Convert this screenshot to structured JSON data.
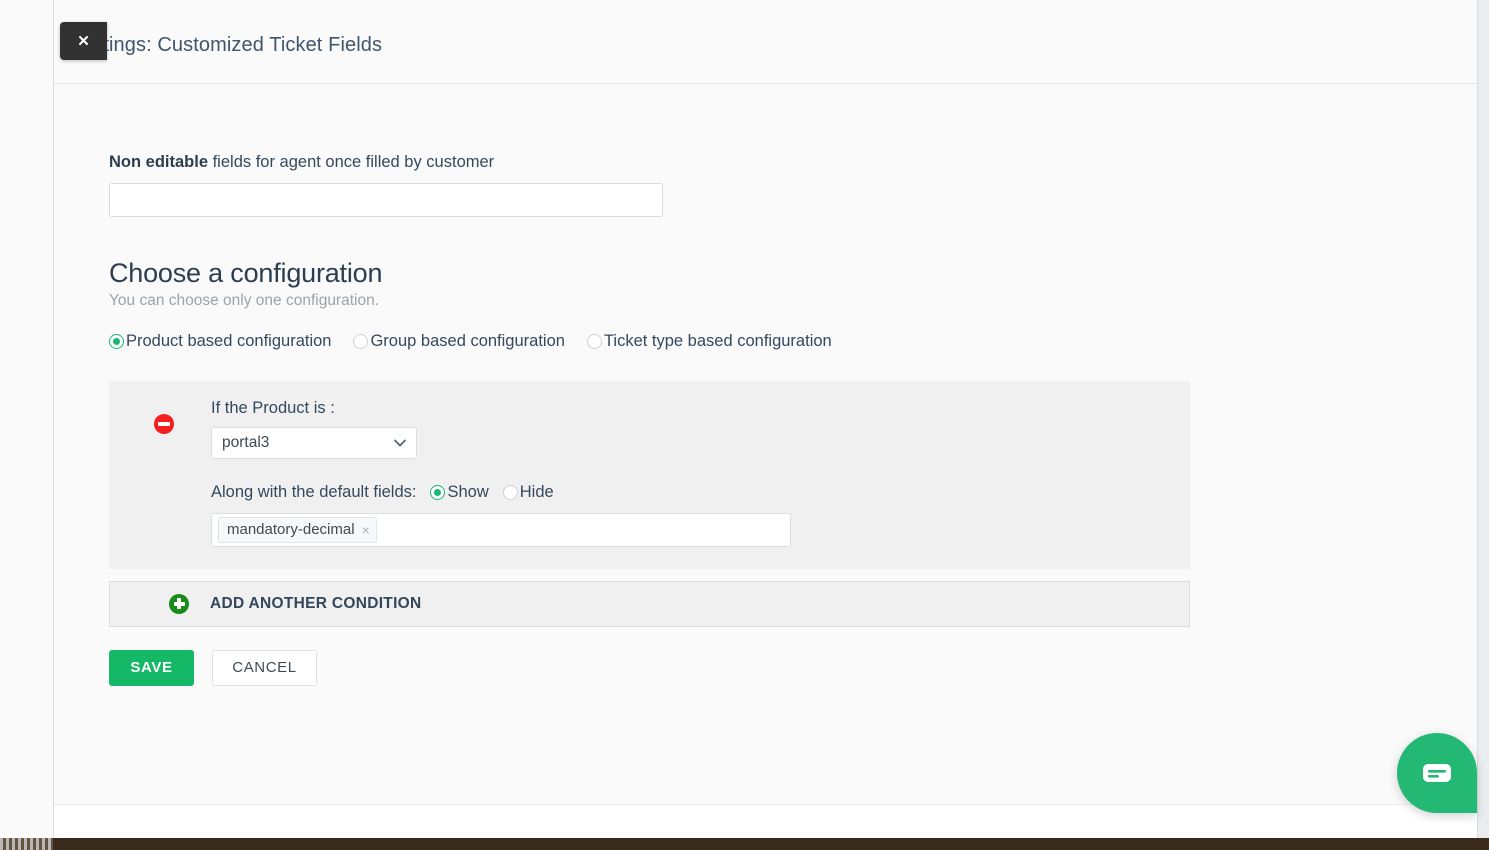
{
  "window": {
    "close_label": "✕",
    "title": "Settings: Customized Ticket Fields"
  },
  "noneditable": {
    "label_bold": "Non editable",
    "label_rest": " fields for agent once filled by customer",
    "value": "",
    "placeholder": ""
  },
  "configuration": {
    "heading": "Choose a configuration",
    "subtitle": "You can choose only one configuration.",
    "options": [
      {
        "label": "Product based configuration",
        "selected": true
      },
      {
        "label": "Group based configuration",
        "selected": false
      },
      {
        "label": "Ticket type based configuration",
        "selected": false
      }
    ]
  },
  "condition": {
    "remove_icon": "remove-circle-icon",
    "if_label": "If the Product is :",
    "product_value": "portal3",
    "default_fields_label": "Along with the default fields:",
    "visibility_options": [
      {
        "label": "Show",
        "selected": true
      },
      {
        "label": "Hide",
        "selected": false
      }
    ],
    "tags": [
      {
        "label": "mandatory-decimal",
        "remove": "×"
      }
    ]
  },
  "add_condition": {
    "icon": "plus-circle-icon",
    "label": "ADD ANOTHER CONDITION"
  },
  "actions": {
    "save_label": "SAVE",
    "cancel_label": "CANCEL"
  },
  "chat_widget": {
    "icon": "chat-bubble-icon"
  },
  "colors": {
    "accent_green": "#14b866",
    "radio_green": "#19b872",
    "remove_red": "#f41f1f",
    "add_green": "#1a8a1a",
    "title_text": "#41566c"
  }
}
